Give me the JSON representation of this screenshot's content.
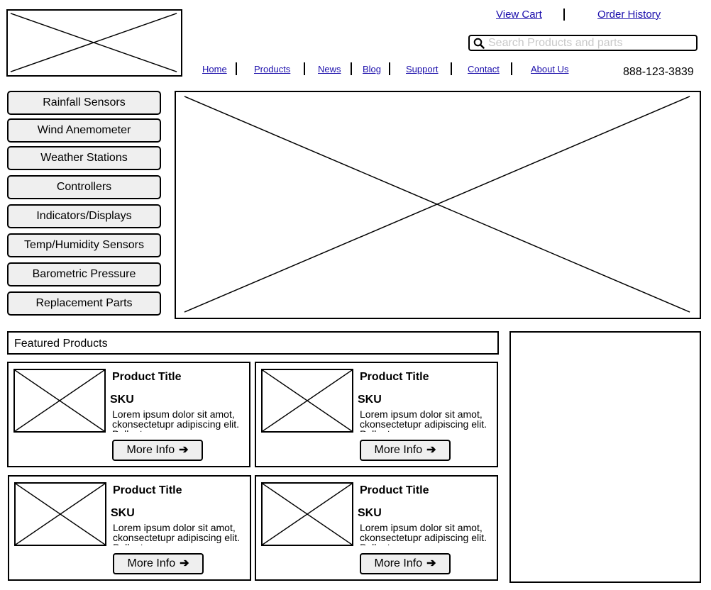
{
  "header": {
    "view_cart": "View Cart",
    "order_history": "Order History",
    "search_placeholder": "Search Products and parts",
    "search_value": "",
    "phone": "888-123-3839"
  },
  "nav": {
    "items": [
      "Home",
      "Products",
      "News",
      "Blog",
      "Support",
      "Contact",
      "About Us"
    ]
  },
  "sidebar": {
    "categories": [
      "Rainfall Sensors",
      "Wind Anemometer",
      "Weather Stations",
      "Controllers",
      "Indicators/Displays",
      "Temp/Humidity Sensors",
      "Barometric Pressure",
      "Replacement Parts"
    ]
  },
  "featured": {
    "label": "Featured Products",
    "products": [
      {
        "title": "Product Title",
        "sku": "SKU",
        "description": "Lorem ipsum dolor sit amot, ckonsectetupr adipiscing elit. Pellentesque eu neque",
        "button": "More Info"
      },
      {
        "title": "Product Title",
        "sku": "SKU",
        "description": "Lorem ipsum dolor sit amot, ckonsectetupr adipiscing elit. Pellentesque eu neque",
        "button": "More Info"
      },
      {
        "title": "Product Title",
        "sku": "SKU",
        "description": "Lorem ipsum dolor sit amot, ckonsectetupr adipiscing elit. Pellentesque eu neque",
        "button": "More Info"
      },
      {
        "title": "Product Title",
        "sku": "SKU",
        "description": "Lorem ipsum dolor sit amot, ckonsectetupr adipiscing elit. Pellentesque eu neque",
        "button": "More Info"
      }
    ]
  },
  "icons": {
    "search": "search-icon",
    "arrow": "arrow-right-icon",
    "image": "image-placeholder-icon"
  }
}
